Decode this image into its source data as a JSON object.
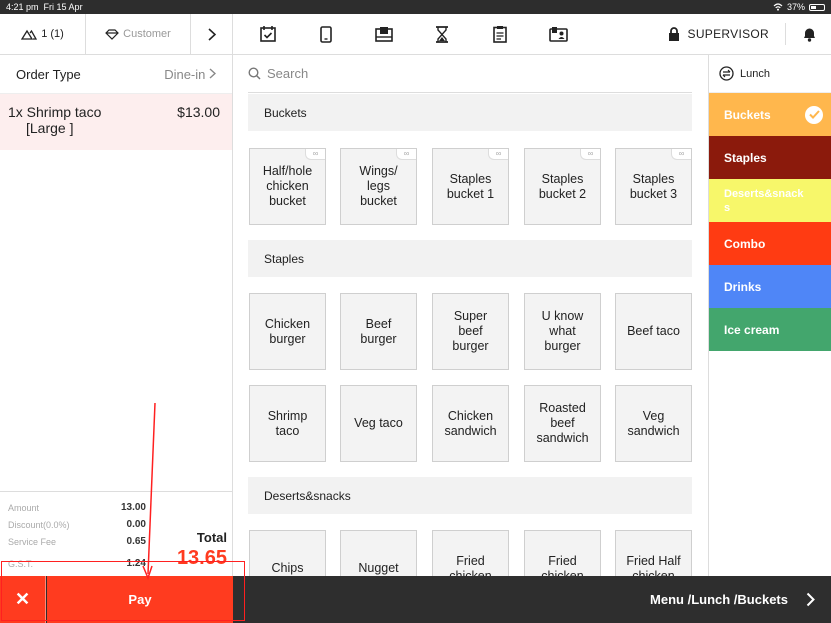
{
  "status": {
    "time": "4:21 pm",
    "date": "Fri 15 Apr",
    "battery": "37%"
  },
  "topbar": {
    "guests": "1 (1)",
    "customer_placeholder": "Customer",
    "icons": [
      "calendar-check-icon",
      "tablet-icon",
      "cash-drawer-icon",
      "hourglass-icon",
      "clipboard-icon",
      "id-card-icon"
    ],
    "role": "SUPERVISOR"
  },
  "order": {
    "type_label": "Order Type",
    "type_value": "Dine-in",
    "items": [
      {
        "qty_name": "1x Shrimp taco",
        "modifier": "[Large ]",
        "price": "$13.00"
      }
    ]
  },
  "summary": {
    "amount_label": "Amount",
    "amount": "13.00",
    "discount_label": "Discount(0.0%)",
    "discount": "0.00",
    "service_label": "Service Fee",
    "service": "0.65",
    "gst_label": "G.S.T.",
    "gst": "1.24",
    "total_label": "Total",
    "total": "13.65"
  },
  "search": {
    "placeholder": "Search"
  },
  "sections": [
    {
      "title": "Buckets",
      "items": [
        {
          "label": "Half/hole\nchicken\nbucket",
          "linked": true
        },
        {
          "label": "Wings/\nlegs\nbucket",
          "linked": true
        },
        {
          "label": "Staples\nbucket 1",
          "linked": true
        },
        {
          "label": "Staples\nbucket 2",
          "linked": true
        },
        {
          "label": "Staples\nbucket 3",
          "linked": true
        }
      ]
    },
    {
      "title": "Staples",
      "items": [
        {
          "label": "Chicken\nburger"
        },
        {
          "label": "Beef\nburger"
        },
        {
          "label": "Super\nbeef\nburger"
        },
        {
          "label": "U know\nwhat\nburger"
        },
        {
          "label": "Beef taco"
        },
        {
          "label": "Shrimp\ntaco"
        },
        {
          "label": "Veg taco"
        },
        {
          "label": "Chicken\nsandwich"
        },
        {
          "label": "Roasted\nbeef\nsandwich"
        },
        {
          "label": "Veg\nsandwich"
        }
      ]
    },
    {
      "title": "Deserts&snacks",
      "items": [
        {
          "label": "Chips"
        },
        {
          "label": "Nugget"
        },
        {
          "label": "Fried\nchicken"
        },
        {
          "label": "Fried\nchicken"
        },
        {
          "label": "Fried Half\nchicken"
        }
      ]
    }
  ],
  "menu": {
    "name": "Lunch",
    "categories": [
      {
        "label": "Buckets",
        "color": "#ffb74d",
        "selected": true
      },
      {
        "label": "Staples",
        "color": "#8b1a0c",
        "selected": false
      },
      {
        "label": "Deserts&snacks",
        "color": "#f7f76a",
        "selected": false
      },
      {
        "label": "Combo",
        "color": "#ff3b12",
        "selected": false
      },
      {
        "label": "Drinks",
        "color": "#4f86f7",
        "selected": false
      },
      {
        "label": "Ice cream",
        "color": "#43a66d",
        "selected": false
      }
    ]
  },
  "footer": {
    "cancel_symbol": "✕",
    "pay_label": "Pay",
    "breadcrumb": "Menu /Lunch /Buckets"
  }
}
